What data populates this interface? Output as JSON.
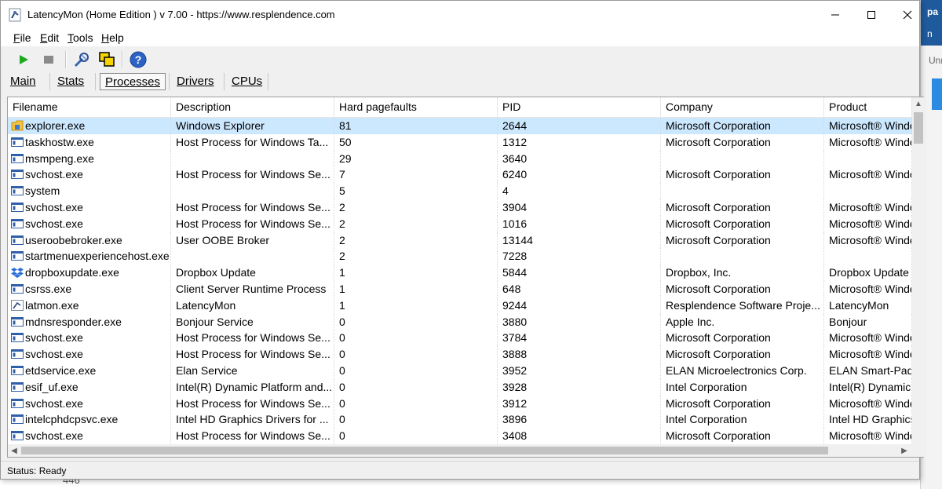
{
  "window": {
    "title": "LatencyMon  (Home Edition )  v 7.00 - https://www.resplendence.com"
  },
  "menu": [
    {
      "label": "File",
      "underline": "F",
      "rest": "ile"
    },
    {
      "label": "Edit",
      "underline": "E",
      "rest": "dit"
    },
    {
      "label": "Tools",
      "underline": "T",
      "rest": "ools"
    },
    {
      "label": "Help",
      "underline": "H",
      "rest": "elp"
    }
  ],
  "toolbar": {
    "icons": [
      "start-icon",
      "stop-icon",
      "latency-tool-icon",
      "windows-icon",
      "help-icon"
    ]
  },
  "tabs": [
    {
      "label": "Main",
      "active": false
    },
    {
      "label": "Stats",
      "active": false
    },
    {
      "label": "Processes",
      "active": true
    },
    {
      "label": "Drivers",
      "active": false
    },
    {
      "label": "CPUs",
      "active": false
    }
  ],
  "table": {
    "columns": [
      "Filename",
      "Description",
      "Hard pagefaults",
      "PID",
      "Company",
      "Product"
    ],
    "rows": [
      {
        "icon": "folder-app-icon",
        "filename": "explorer.exe",
        "description": "Windows Explorer",
        "pagefaults": "81",
        "pid": "2644",
        "company": "Microsoft Corporation",
        "product": "Microsoft® Windo",
        "selected": true
      },
      {
        "icon": "app-window-icon",
        "filename": "taskhostw.exe",
        "description": "Host Process for Windows Ta...",
        "pagefaults": "50",
        "pid": "1312",
        "company": "Microsoft Corporation",
        "product": "Microsoft® Windo"
      },
      {
        "icon": "app-window-icon",
        "filename": "msmpeng.exe",
        "description": "",
        "pagefaults": "29",
        "pid": "3640",
        "company": "",
        "product": ""
      },
      {
        "icon": "app-window-icon",
        "filename": "svchost.exe",
        "description": "Host Process for Windows Se...",
        "pagefaults": "7",
        "pid": "6240",
        "company": "Microsoft Corporation",
        "product": "Microsoft® Windo"
      },
      {
        "icon": "app-window-icon",
        "filename": "system",
        "description": "",
        "pagefaults": "5",
        "pid": "4",
        "company": "",
        "product": ""
      },
      {
        "icon": "app-window-icon",
        "filename": "svchost.exe",
        "description": "Host Process for Windows Se...",
        "pagefaults": "2",
        "pid": "3904",
        "company": "Microsoft Corporation",
        "product": "Microsoft® Windo"
      },
      {
        "icon": "app-window-icon",
        "filename": "svchost.exe",
        "description": "Host Process for Windows Se...",
        "pagefaults": "2",
        "pid": "1016",
        "company": "Microsoft Corporation",
        "product": "Microsoft® Windo"
      },
      {
        "icon": "app-window-icon",
        "filename": "useroobebroker.exe",
        "description": "User OOBE Broker",
        "pagefaults": "2",
        "pid": "13144",
        "company": "Microsoft Corporation",
        "product": "Microsoft® Windo"
      },
      {
        "icon": "app-window-icon",
        "filename": "startmenuexperiencehost.exe",
        "description": "",
        "pagefaults": "2",
        "pid": "7228",
        "company": "",
        "product": ""
      },
      {
        "icon": "dropbox-icon",
        "filename": "dropboxupdate.exe",
        "description": "Dropbox Update",
        "pagefaults": "1",
        "pid": "5844",
        "company": "Dropbox, Inc.",
        "product": "Dropbox Update"
      },
      {
        "icon": "app-window-icon",
        "filename": "csrss.exe",
        "description": "Client Server Runtime Process",
        "pagefaults": "1",
        "pid": "648",
        "company": "Microsoft Corporation",
        "product": "Microsoft® Windo"
      },
      {
        "icon": "latmon-icon",
        "filename": "latmon.exe",
        "description": "LatencyMon",
        "pagefaults": "1",
        "pid": "9244",
        "company": "Resplendence Software Proje...",
        "product": "LatencyMon"
      },
      {
        "icon": "app-window-icon",
        "filename": "mdnsresponder.exe",
        "description": "Bonjour Service",
        "pagefaults": "0",
        "pid": "3880",
        "company": "Apple Inc.",
        "product": "Bonjour"
      },
      {
        "icon": "app-window-icon",
        "filename": "svchost.exe",
        "description": "Host Process for Windows Se...",
        "pagefaults": "0",
        "pid": "3784",
        "company": "Microsoft Corporation",
        "product": "Microsoft® Windo"
      },
      {
        "icon": "app-window-icon",
        "filename": "svchost.exe",
        "description": "Host Process for Windows Se...",
        "pagefaults": "0",
        "pid": "3888",
        "company": "Microsoft Corporation",
        "product": "Microsoft® Windo"
      },
      {
        "icon": "app-window-icon",
        "filename": "etdservice.exe",
        "description": "Elan Service",
        "pagefaults": "0",
        "pid": "3952",
        "company": "ELAN Microelectronics Corp.",
        "product": "ELAN Smart-Pad"
      },
      {
        "icon": "app-window-icon",
        "filename": "esif_uf.exe",
        "description": "Intel(R) Dynamic Platform and...",
        "pagefaults": "0",
        "pid": "3928",
        "company": "Intel Corporation",
        "product": "Intel(R) Dynamic"
      },
      {
        "icon": "app-window-icon",
        "filename": "svchost.exe",
        "description": "Host Process for Windows Se...",
        "pagefaults": "0",
        "pid": "3912",
        "company": "Microsoft Corporation",
        "product": "Microsoft® Windo"
      },
      {
        "icon": "app-window-icon",
        "filename": "intelcphdcpsvc.exe",
        "description": "Intel HD Graphics Drivers for ...",
        "pagefaults": "0",
        "pid": "3896",
        "company": "Intel Corporation",
        "product": "Intel HD Graphics"
      },
      {
        "icon": "app-window-icon",
        "filename": "svchost.exe",
        "description": "Host Process for Windows Se...",
        "pagefaults": "0",
        "pid": "3408",
        "company": "Microsoft Corporation",
        "product": "Microsoft® Windo"
      }
    ]
  },
  "status": {
    "text": "Status: Ready"
  },
  "background": {
    "top_text": "pa",
    "second_text": "n",
    "third_text": "Unre",
    "under_text": "446"
  },
  "colors": {
    "selection": "#cce8ff",
    "window_bg": "#f0f0f0"
  }
}
